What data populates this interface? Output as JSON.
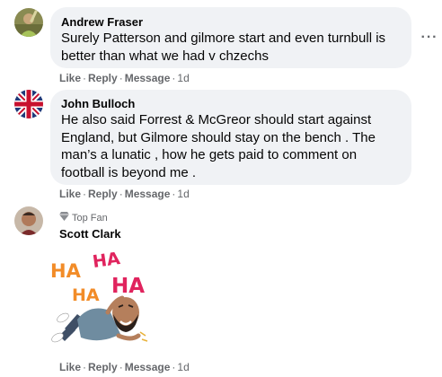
{
  "comments": [
    {
      "author": "Andrew Fraser",
      "text": "Surely Patterson and gilmore start and even turnbull is\nbetter than what we had v chzechs",
      "like": "Like",
      "reply": "Reply",
      "message": "Message",
      "time": "1d",
      "more_icon": "more-options-icon"
    },
    {
      "author": "John Bulloch",
      "text": "He also said Forrest & McGreor should start against\nEngland, but Gilmore should stay on the bench . The\nman’s a lunatic , how he gets paid to comment on\nfootball is beyond me .",
      "like": "Like",
      "reply": "Reply",
      "message": "Message",
      "time": "1d"
    },
    {
      "author": "Scott Clark",
      "badge": "Top Fan",
      "badge_icon": "diamond-icon",
      "sticker": {
        "ha_1": "HA",
        "ha_2": "HA",
        "ha_3": "HA",
        "ha_4": "HA"
      },
      "like": "Like",
      "reply": "Reply",
      "message": "Message",
      "time": "1d"
    }
  ],
  "colors": {
    "bubble": "#f0f2f5",
    "meta": "#65676b",
    "text": "#050505",
    "ha_orange": "#f28c28",
    "ha_red": "#e0245e"
  }
}
